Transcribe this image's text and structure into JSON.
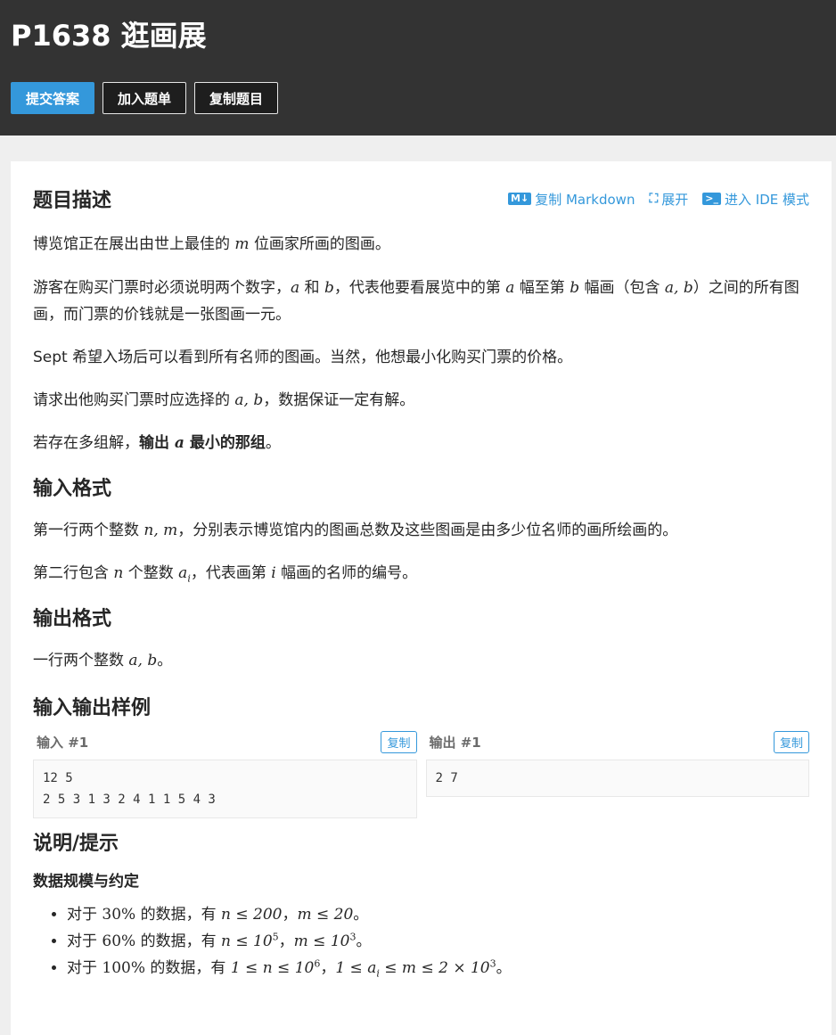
{
  "header": {
    "title": "P1638 逛画展",
    "buttons": {
      "submit": "提交答案",
      "add_list": "加入题单",
      "copy_problem": "复制题目"
    }
  },
  "actions": {
    "copy_markdown": "复制 Markdown",
    "expand": "展开",
    "ide_mode": "进入 IDE 模式",
    "md_icon": "M↓"
  },
  "description": {
    "heading": "题目描述",
    "p1_a": "博览馆正在展出由世上最佳的",
    "p1_b": "位画家所画的图画。",
    "p2_a": "游客在购买门票时必须说明两个数字，",
    "p2_b": "和",
    "p2_c": "，代表他要看展览中的第",
    "p2_d": "幅至第",
    "p2_e": "幅画（包含",
    "p2_f": "）之间的所有图画，而门票的价钱就是一张图画一元。",
    "p3": "Sept 希望入场后可以看到所有名师的图画。当然，他想最小化购买门票的价格。",
    "p4_a": "请求出他购买门票时应选择的",
    "p4_b": "，数据保证一定有解。",
    "p5_a": "若存在多组解，",
    "p5_b": "输出",
    "p5_c": "最小的那组",
    "p5_d": "。"
  },
  "input_format": {
    "heading": "输入格式",
    "p1_a": "第一行两个整数",
    "p1_b": "，分别表示博览馆内的图画总数及这些图画是由多少位名师的画所绘画的。",
    "p2_a": "第二行包含",
    "p2_b": "个整数",
    "p2_c": "，代表画第",
    "p2_d": "幅画的名师的编号。"
  },
  "output_format": {
    "heading": "输出格式",
    "p1_a": "一行两个整数",
    "p1_b": "。"
  },
  "samples": {
    "heading": "输入输出样例",
    "input_label": "输入 #1",
    "output_label": "输出 #1",
    "copy": "复制",
    "input": "12 5\n2 5 3 1 3 2 4 1 1 5 4 3",
    "output": "2 7"
  },
  "hints": {
    "heading": "说明/提示",
    "subheading": "数据规模与约定",
    "items": [
      {
        "a": "对于 ",
        "pct": "30%",
        "b": " 的数据，有 ",
        "c": "，",
        "d": "。"
      },
      {
        "a": "对于 ",
        "pct": "60%",
        "b": " 的数据，有 ",
        "c": "，",
        "d": "。"
      },
      {
        "a": "对于 ",
        "pct": "100%",
        "b": " 的数据，有 ",
        "c": "，",
        "d": "。"
      }
    ]
  },
  "math": {
    "m": "m",
    "a": "a",
    "b": "b",
    "ab": "a, b",
    "nm": "n, m",
    "n": "n",
    "ai": "a",
    "ai_sub": "i",
    "i": "i",
    "h1_n": "n ≤ 200",
    "h1_m": "m ≤ 20",
    "h2_n": "n ≤ 10",
    "h2_n_sup": "5",
    "h2_m": "m ≤ 10",
    "h2_m_sup": "3",
    "h3_n": "1 ≤ n ≤ 10",
    "h3_n_sup": "6",
    "h3_m1": "1 ≤ a",
    "h3_m_sub": "i",
    "h3_m2": " ≤ m ≤ 2 × 10",
    "h3_m_sup": "3"
  }
}
